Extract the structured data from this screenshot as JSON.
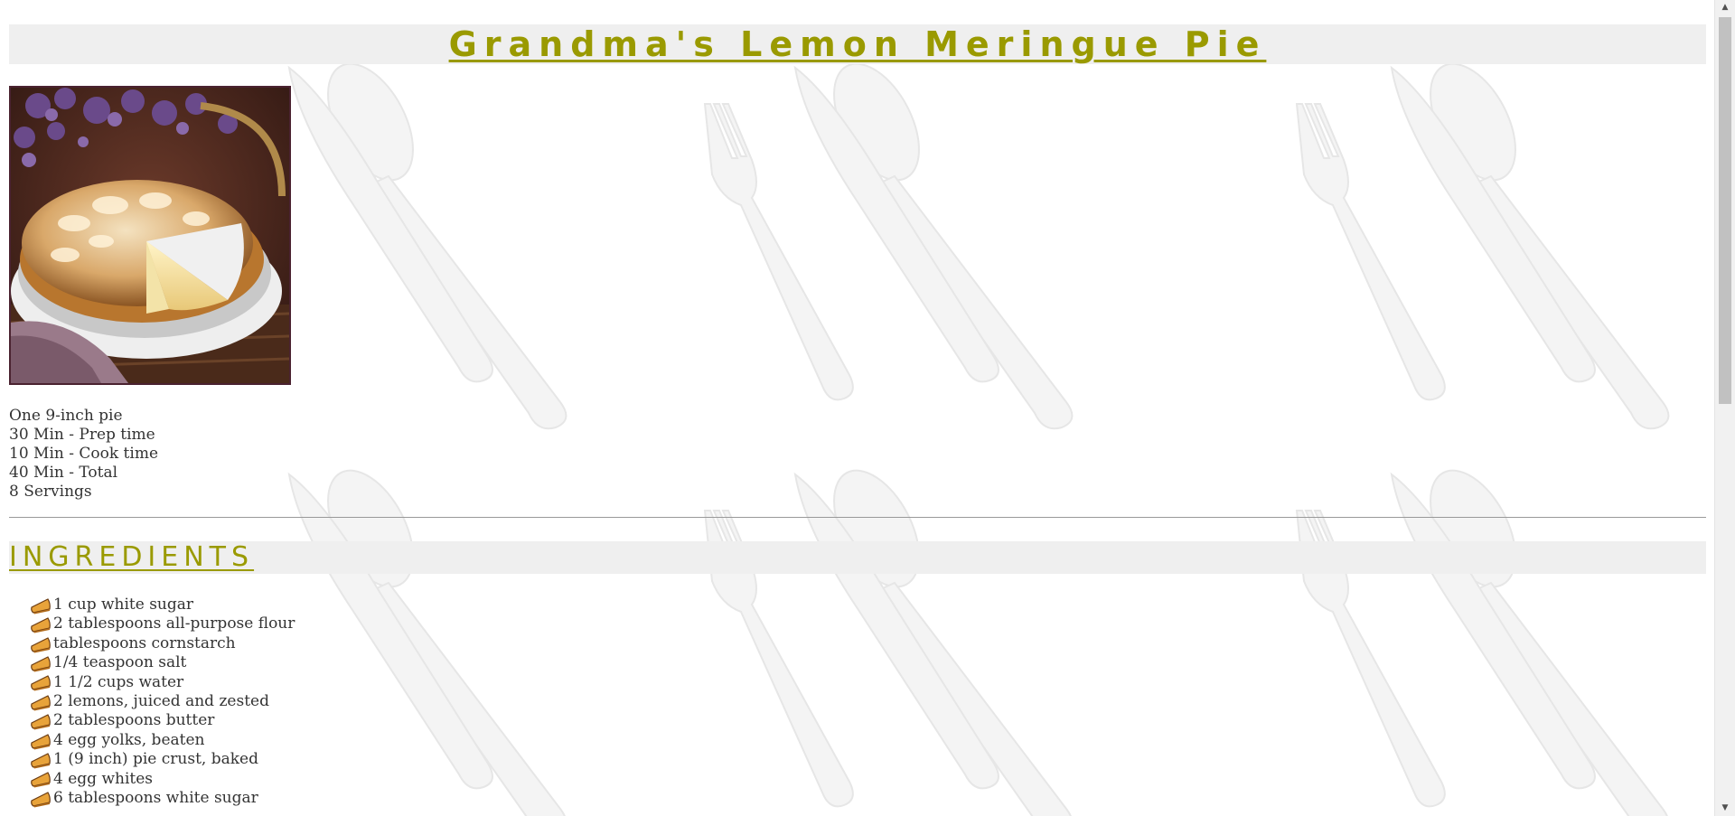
{
  "title": "Grandma's Lemon Meringue Pie",
  "image": {
    "alt": "Lemon meringue pie photo"
  },
  "facts": [
    "One 9-inch pie",
    "30 Min - Prep time",
    "10 Min - Cook time",
    "40 Min - Total",
    "8 Servings"
  ],
  "ingredients_heading": "INGREDIENTS",
  "ingredients": [
    "1 cup white sugar",
    "2 tablespoons all-purpose flour",
    "tablespoons cornstarch",
    "1/4 teaspoon salt",
    "1 1/2 cups water",
    "2 lemons, juiced and zested",
    "2 tablespoons butter",
    "4 egg yolks, beaten",
    "1 (9 inch) pie crust, baked",
    "4 egg whites",
    "6 tablespoons white sugar"
  ],
  "icons": {
    "bullet": "pie-slice-icon",
    "scroll_up": "scroll-up-arrow-icon",
    "scroll_down": "scroll-down-arrow-icon"
  },
  "colors": {
    "heading": "#9a9a00",
    "heading_bar": "#efefef",
    "body_text": "#333333"
  }
}
